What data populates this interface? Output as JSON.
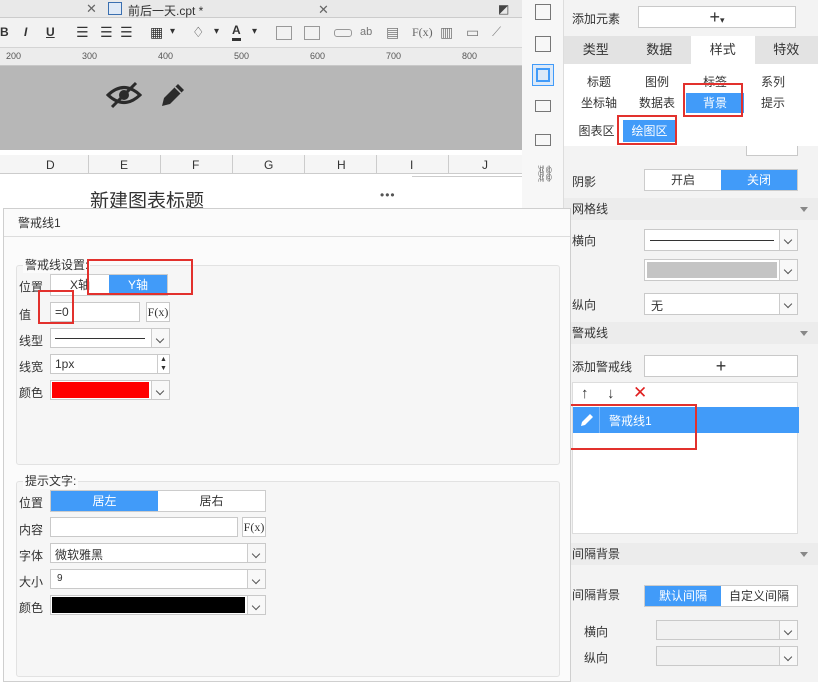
{
  "tabs": [
    {
      "label": "前后一天.cpt *"
    }
  ],
  "toolbar": {
    "bold": "B",
    "italic": "I",
    "underline": "U",
    "fx": "F(x)"
  },
  "ruler": {
    "marks": [
      "200",
      "300",
      "400",
      "500",
      "600",
      "700",
      "800"
    ]
  },
  "columns": [
    "D",
    "E",
    "F",
    "G",
    "H",
    "I",
    "J"
  ],
  "chart_title": "新建图表标题",
  "more_menu": "•••",
  "dialog": {
    "title": "警戒线1",
    "settings": {
      "label": "警戒线设置:",
      "position_label": "位置",
      "position_options": [
        "X轴",
        "Y轴"
      ],
      "value_label": "值",
      "value": "=0",
      "fx": "F(x)",
      "line_type_label": "线型",
      "line_width_label": "线宽",
      "line_width_value": "1px",
      "color_label": "颜色",
      "color_value": "#ff0000"
    },
    "hint": {
      "label": "提示文字:",
      "position_label": "位置",
      "position_options": [
        "居左",
        "居右"
      ],
      "content_label": "内容",
      "content_value": "",
      "fx": "F(x)",
      "font_label": "字体",
      "font_value": "微软雅黑",
      "size_label": "大小",
      "size_value": "9",
      "color_label": "颜色",
      "color_value": "#000000"
    }
  },
  "right_panel": {
    "add_element_label": "添加元素",
    "add_symbol": "+",
    "main_tabs": [
      "类型",
      "数据",
      "样式",
      "特效"
    ],
    "sub_tabs_row1": [
      "标题",
      "图例",
      "标签",
      "系列"
    ],
    "sub_tabs_row2": [
      "坐标轴",
      "数据表",
      "背景",
      "提示"
    ],
    "area_tabs": [
      "图表区",
      "绘图区"
    ],
    "shadow_label": "阴影",
    "shadow_options": [
      "开启",
      "关闭"
    ],
    "grid_section": "网格线",
    "horizontal_label": "横向",
    "vertical_label": "纵向",
    "vertical_value": "无",
    "alert_section": "警戒线",
    "add_alert_label": "添加警戒线",
    "alert_item": "警戒线1",
    "interval_section": "间隔背景",
    "interval_label": "间隔背景",
    "interval_options": [
      "默认间隔",
      "自定义间隔"
    ],
    "interval_horizontal": "横向",
    "interval_vertical": "纵向"
  },
  "colors": {
    "accent": "#419bf9",
    "annotation": "#e2312d",
    "alert_color": "#ff0000"
  }
}
